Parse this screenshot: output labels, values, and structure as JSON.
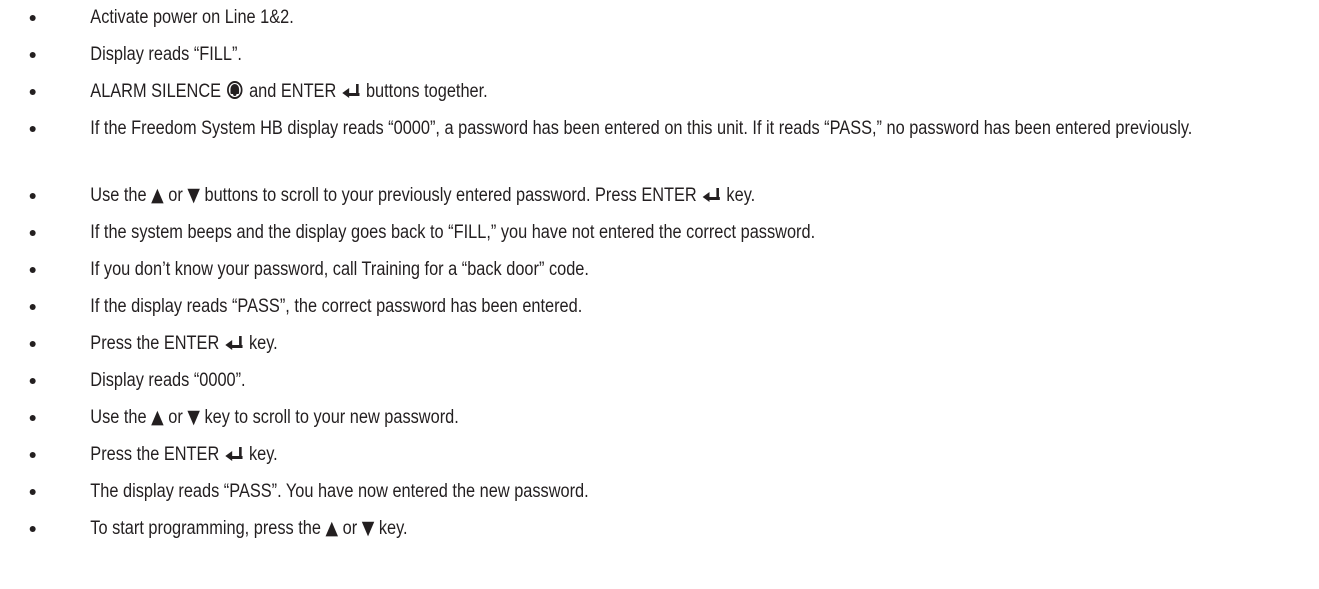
{
  "steps": [
    {
      "text": "Activate power on Line 1&2."
    },
    {
      "text": "Display reads “FILL”."
    },
    {
      "a": "ALARM SILENCE",
      "b": "and ENTER",
      "c": "buttons together."
    },
    {
      "text": "If the Freedom System HB display reads “0000”, a password has been entered on this unit. If it reads “PASS,” no password has been entered previously."
    },
    {
      "a": "Use the",
      "b": "or",
      "c": "buttons to scroll to your previously entered password. Press ENTER",
      "d": "key."
    },
    {
      "text": "If the system beeps and the display goes back to “FILL,” you have not entered the correct password."
    },
    {
      "text": "If you don’t know your password, call Training for a “back door” code."
    },
    {
      "text": "If the display reads “PASS”, the correct password has been entered."
    },
    {
      "a": "Press the ENTER",
      "b": "key."
    },
    {
      "text": "Display reads “0000”."
    },
    {
      "a": "Use the",
      "b": "or",
      "c": "key to scroll to your new password."
    },
    {
      "a": "Press the ENTER",
      "b": "key."
    },
    {
      "text": "The display reads “PASS”. You have now entered the new password."
    },
    {
      "a": "To start programming, press the",
      "b": "or",
      "c": "key."
    }
  ],
  "icons": {
    "up_arrow": "▲",
    "down_arrow": "▼",
    "enter": "enter-key-icon",
    "alarm_silence": "alarm-silence-bell-icon"
  }
}
